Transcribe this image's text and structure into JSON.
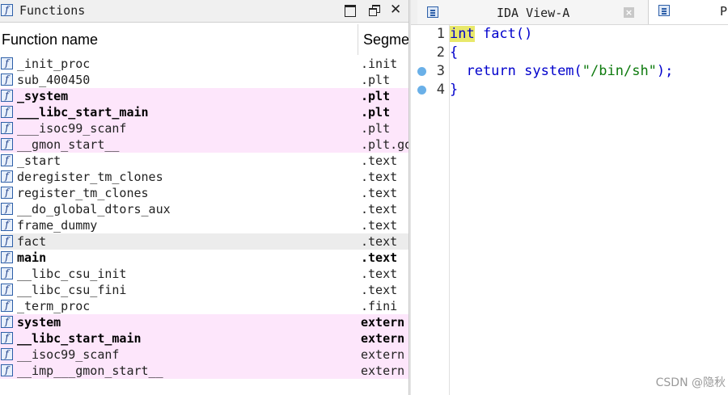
{
  "functions_panel": {
    "title": "Functions",
    "columns": {
      "name": "Function name",
      "segment": "Segment"
    },
    "rows": [
      {
        "name": "_init_proc",
        "segment": ".init",
        "imported": false,
        "bold": false
      },
      {
        "name": "sub_400450",
        "segment": ".plt",
        "imported": false,
        "bold": false
      },
      {
        "name": "_system",
        "segment": ".plt",
        "imported": true,
        "bold": true
      },
      {
        "name": "___libc_start_main",
        "segment": ".plt",
        "imported": true,
        "bold": true
      },
      {
        "name": "___isoc99_scanf",
        "segment": ".plt",
        "imported": true,
        "bold": false
      },
      {
        "name": "__gmon_start__",
        "segment": ".plt.got",
        "imported": true,
        "bold": false
      },
      {
        "name": "_start",
        "segment": ".text",
        "imported": false,
        "bold": false
      },
      {
        "name": "deregister_tm_clones",
        "segment": ".text",
        "imported": false,
        "bold": false
      },
      {
        "name": "register_tm_clones",
        "segment": ".text",
        "imported": false,
        "bold": false
      },
      {
        "name": "__do_global_dtors_aux",
        "segment": ".text",
        "imported": false,
        "bold": false
      },
      {
        "name": "frame_dummy",
        "segment": ".text",
        "imported": false,
        "bold": false
      },
      {
        "name": "fact",
        "segment": ".text",
        "imported": false,
        "bold": false,
        "selected": true
      },
      {
        "name": "main",
        "segment": ".text",
        "imported": false,
        "bold": true
      },
      {
        "name": "__libc_csu_init",
        "segment": ".text",
        "imported": false,
        "bold": false
      },
      {
        "name": "__libc_csu_fini",
        "segment": ".text",
        "imported": false,
        "bold": false
      },
      {
        "name": "_term_proc",
        "segment": ".fini",
        "imported": false,
        "bold": false
      },
      {
        "name": "system",
        "segment": "extern",
        "imported": true,
        "bold": true
      },
      {
        "name": "__libc_start_main",
        "segment": "extern",
        "imported": true,
        "bold": true
      },
      {
        "name": "__isoc99_scanf",
        "segment": "extern",
        "imported": true,
        "bold": false
      },
      {
        "name": "__imp___gmon_start__",
        "segment": "extern",
        "imported": true,
        "bold": false
      }
    ]
  },
  "tabs": [
    {
      "label": "IDA View-A"
    },
    {
      "label": "Ps"
    }
  ],
  "code": {
    "lines": [
      {
        "num": "1",
        "parts": [
          [
            "kw hl",
            "int"
          ],
          [
            "fn",
            " fact"
          ],
          [
            "punct",
            "()"
          ]
        ],
        "breakpoint": false
      },
      {
        "num": "2",
        "parts": [
          [
            "punct",
            "{"
          ]
        ],
        "breakpoint": false
      },
      {
        "num": "3",
        "parts": [
          [
            "kw",
            "  return"
          ],
          [
            "fn",
            " system"
          ],
          [
            "punct",
            "("
          ],
          [
            "str",
            "\"/bin/sh\""
          ],
          [
            "punct",
            ");"
          ]
        ],
        "breakpoint": true
      },
      {
        "num": "4",
        "parts": [
          [
            "punct",
            "}"
          ]
        ],
        "breakpoint": true
      }
    ]
  },
  "colors": {
    "imported_row_bg": "#fde6fb",
    "selected_row_bg": "#ececec",
    "keyword": "#0000cc",
    "string": "#0d7a0d",
    "highlight": "#e8e86a"
  },
  "watermark": "CSDN @隐秋"
}
